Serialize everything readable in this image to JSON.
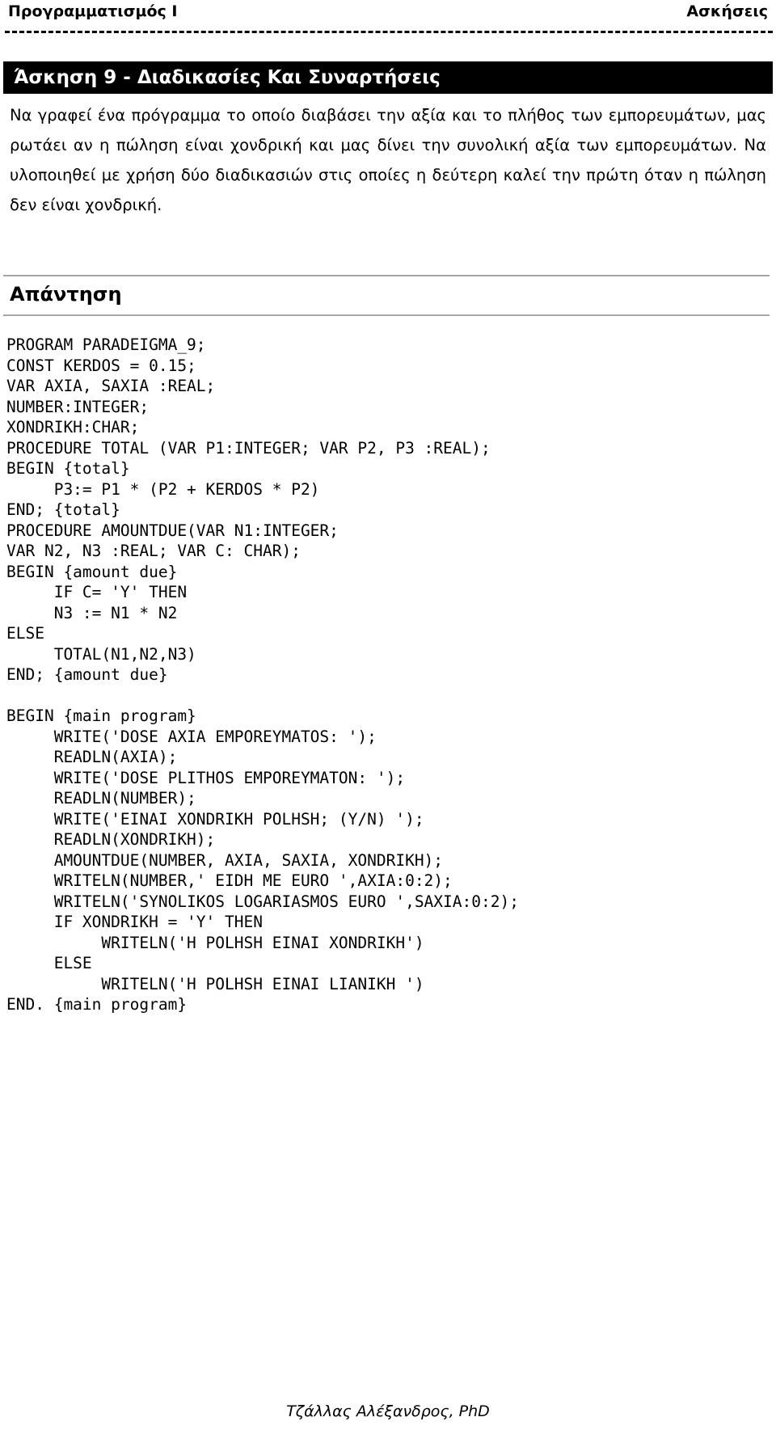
{
  "header": {
    "left_title": "Προγραμματισμός Ι",
    "right_title": "Ασκήσεις"
  },
  "exercise": {
    "title": "Άσκηση 9 - Διαδικασίες Και Συναρτήσεις",
    "statement": "Να γραφεί ένα πρόγραμμα το οποίο διαβάσει την αξία και το πλήθος των εμπορευμάτων, μας ρωτάει αν η πώληση είναι χονδρική και μας δίνει την συνολική αξία των εμπορευμάτων. Να υλοποιηθεί με χρήση δύο διαδικασιών στις οποίες η δεύτερη καλεί την πρώτη όταν η πώληση δεν είναι χονδρική."
  },
  "answer": {
    "heading": "Απάντηση",
    "code_lines": [
      "PROGRAM PARADEIGMA_9;",
      "CONST KERDOS = 0.15;",
      "VAR AXIA, SAXIA :REAL;",
      "NUMBER:INTEGER;",
      "XONDRIKH:CHAR;",
      "PROCEDURE TOTAL (VAR P1:INTEGER; VAR P2, P3 :REAL);",
      "BEGIN {total}",
      "     P3:= P1 * (P2 + KERDOS * P2)",
      "END; {total}",
      "PROCEDURE AMOUNTDUE(VAR N1:INTEGER;",
      "VAR N2, N3 :REAL; VAR C: CHAR);",
      "BEGIN {amount due}",
      "     IF C= 'Y' THEN",
      "     N3 := N1 * N2",
      "ELSE",
      "     TOTAL(N1,N2,N3)",
      "END; {amount due}",
      "",
      "BEGIN {main program}",
      "     WRITE('DOSE AXIA EMPOREYMATOS: ');",
      "     READLN(AXIA);",
      "     WRITE('DOSE PLITHOS EMPOREYMATON: ');",
      "     READLN(NUMBER);",
      "     WRITE('EINAI XONDRIKH POLHSH; (Y/N) ');",
      "     READLN(XONDRIKH);",
      "     AMOUNTDUE(NUMBER, AXIA, SAXIA, XONDRIKH);",
      "     WRITELN(NUMBER,' EIDH ME EURO ',AXIA:0:2);",
      "     WRITELN('SYNOLIKOS LOGARIASMOS EURO ',SAXIA:0:2);",
      "     IF XONDRIKH = 'Y' THEN",
      "          WRITELN('H POLHSH EINAI XONDRIKH')",
      "     ELSE",
      "          WRITELN('H POLHSH EINAI LIANIKH ')",
      "END. {main program}"
    ]
  },
  "footer": {
    "author": "Τζάλλας Αλέξανδρος, PhD"
  },
  "colors": {
    "title_band_background": "#000000",
    "title_band_text": "#ffffff",
    "rule_gray": "#a6a6a6",
    "body_text": "#000000",
    "page_background": "#ffffff"
  }
}
